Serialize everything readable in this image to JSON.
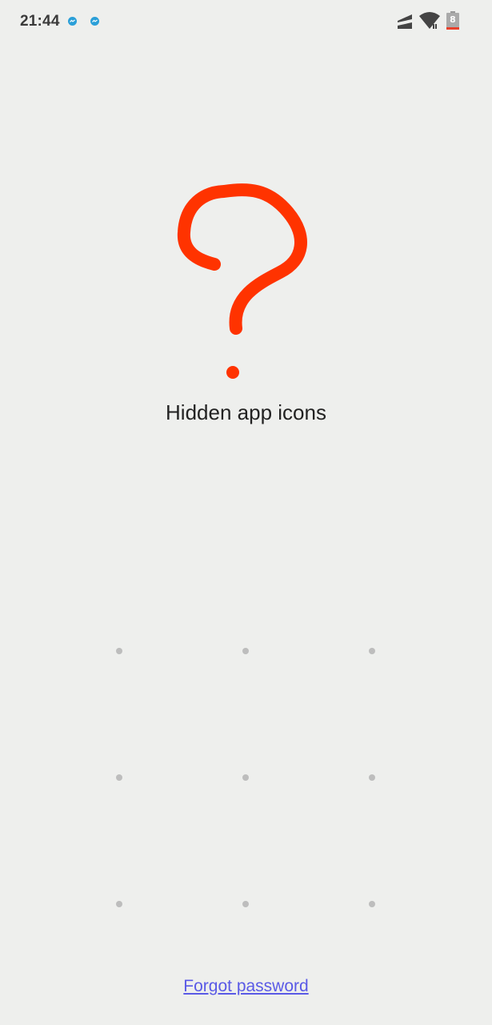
{
  "status_bar": {
    "time": "21:44",
    "notifications": [
      "messenger-icon",
      "messenger-icon"
    ],
    "battery_level": "8",
    "accent_color": "#2a9fd8",
    "battery_warning_color": "#e8402c"
  },
  "main": {
    "title": "Hidden app icons",
    "icon": "question-mark-icon",
    "icon_color": "#ff3300"
  },
  "pattern_lock": {
    "rows": 3,
    "cols": 3,
    "dot_color": "#bdbdbd"
  },
  "footer": {
    "forgot_label": "Forgot password",
    "link_color": "#5a5ae6"
  }
}
